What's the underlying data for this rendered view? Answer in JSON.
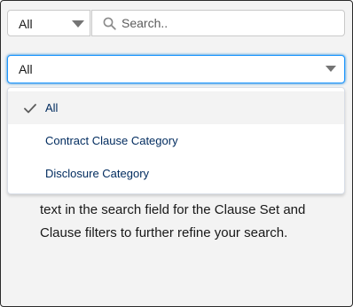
{
  "toolbar": {
    "scope_value": "All",
    "search_placeholder": "Search.."
  },
  "filter": {
    "selected_value": "All",
    "options": [
      {
        "label": "All",
        "selected": true
      },
      {
        "label": "Contract Clause Category",
        "selected": false
      },
      {
        "label": "Disclosure Category",
        "selected": false
      }
    ]
  },
  "help_text": "text in the search field for the Clause Set and Clause filters to further refine your search.",
  "colors": {
    "focus_border": "#1b96ff",
    "option_text": "#032d60",
    "selected_row": "#f3f3f3"
  },
  "icons": {
    "search": "search-icon",
    "check": "check-icon",
    "caret": "chevron-down-icon"
  }
}
